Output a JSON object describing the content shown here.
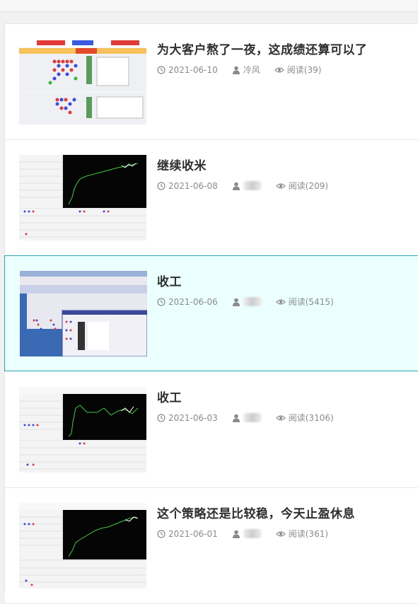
{
  "posts": [
    {
      "title": "为大客户熬了一夜，这成绩还算可以了",
      "date": "2021-06-10",
      "author": "冷风",
      "views": "阅读(39)",
      "thumb": "grid"
    },
    {
      "title": "继续收米",
      "date": "2021-06-08",
      "author": "",
      "views": "阅读(209)",
      "thumb": "chart"
    },
    {
      "title": "收工",
      "date": "2021-06-06",
      "author": "",
      "views": "阅读(5415)",
      "thumb": "desktop"
    },
    {
      "title": "收工",
      "date": "2021-06-03",
      "author": "",
      "views": "阅读(3106)",
      "thumb": "chart"
    },
    {
      "title": "这个策略还是比较稳，今天止盈休息",
      "date": "2021-06-01",
      "author": "",
      "views": "阅读(361)",
      "thumb": "chart"
    }
  ],
  "colors": {
    "accent_border": "#29a8b4",
    "active_bg": "#ebffff",
    "title": "#2f2f2f",
    "meta": "#8a8a8a"
  },
  "icons": {
    "date": "clock-icon",
    "author": "user-icon",
    "views": "eye-icon"
  }
}
